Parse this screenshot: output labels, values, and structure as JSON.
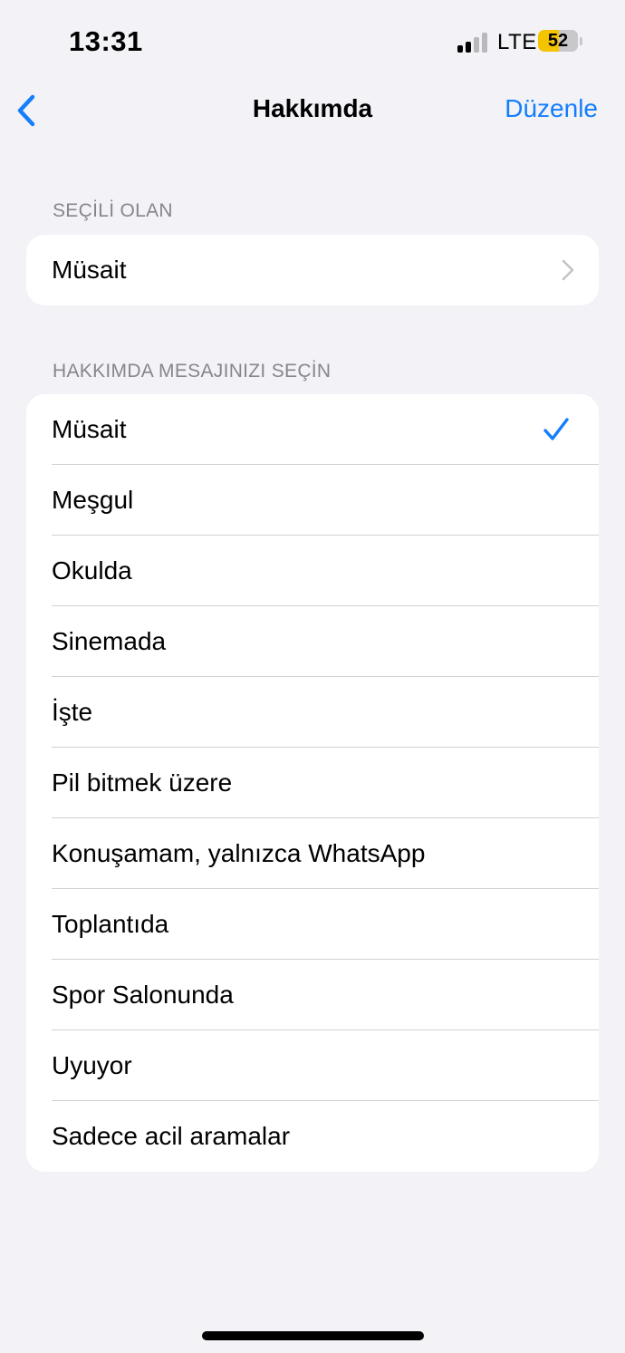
{
  "status_bar": {
    "time": "13:31",
    "network": "LTE",
    "battery_percent": "52",
    "battery_level": 0.52,
    "signal_bars_active": 2,
    "signal_bars_total": 4
  },
  "nav": {
    "title": "Hakkımda",
    "edit_label": "Düzenle",
    "back_icon": "chevron-left-icon"
  },
  "current_section": {
    "header": "SEÇİLİ OLAN",
    "value": "Müsait"
  },
  "choices_section": {
    "header": "HAKKIMDA MESAJINIZI SEÇİN",
    "items": [
      {
        "label": "Müsait",
        "selected": true
      },
      {
        "label": "Meşgul",
        "selected": false
      },
      {
        "label": "Okulda",
        "selected": false
      },
      {
        "label": "Sinemada",
        "selected": false
      },
      {
        "label": "İşte",
        "selected": false
      },
      {
        "label": "Pil bitmek üzere",
        "selected": false
      },
      {
        "label": "Konuşamam, yalnızca WhatsApp",
        "selected": false
      },
      {
        "label": "Toplantıda",
        "selected": false
      },
      {
        "label": "Spor Salonunda",
        "selected": false
      },
      {
        "label": "Uyuyor",
        "selected": false
      },
      {
        "label": "Sadece acil aramalar",
        "selected": false
      }
    ]
  },
  "colors": {
    "accent": "#147efb",
    "background": "#f2f2f7",
    "battery": "#f5c400"
  }
}
